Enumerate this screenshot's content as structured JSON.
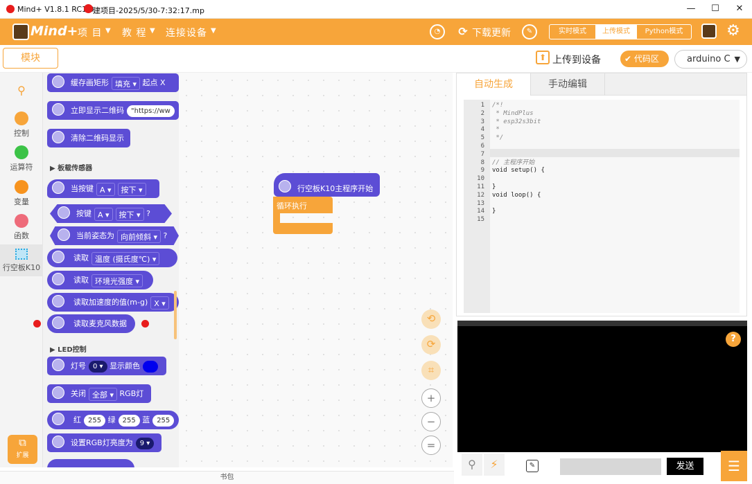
{
  "titlebar": {
    "app": "Mind+ V1.8.1 RC1.0",
    "file": "建项目-2025/5/30-7:32:17.mp",
    "minimize": "—",
    "maximize": "☐",
    "close": "✕"
  },
  "menubar": {
    "logo": "Mind+",
    "menus": [
      "项 目",
      "教 程",
      "连接设备"
    ],
    "download_update": "下载更新",
    "modes": [
      "实时模式",
      "上传模式",
      "Python模式"
    ],
    "active_mode": "上传模式"
  },
  "toolbar": {
    "modules_tab": "模块",
    "upload_button": "上传到设备",
    "code_area_button": "代码区",
    "board_select": "arduino C"
  },
  "categories": [
    {
      "label": "",
      "icon": "search-icon",
      "color": "#f7a53a"
    },
    {
      "label": "控制",
      "color": "#f7a53a"
    },
    {
      "label": "运算符",
      "color": "#3cc347"
    },
    {
      "label": "变量",
      "color": "#f7931e"
    },
    {
      "label": "函数",
      "color": "#ee6b7a"
    },
    {
      "label": "行空板K10",
      "color": "#2aa9e0"
    }
  ],
  "palette": {
    "b1": {
      "text": "缓存画矩形",
      "dd1": "填充 ▾",
      "tail": "起点 X"
    },
    "b2": {
      "text": "立即显示二维码",
      "pill": "\"https://ww"
    },
    "b3": {
      "text": "清除二维码显示"
    },
    "sec1": "▶ 板载传感器",
    "b4": {
      "text": "当按键",
      "dd1": "A ▾",
      "dd2": "按下 ▾"
    },
    "b5": {
      "text": "按键",
      "dd1": "A ▾",
      "dd2": "按下 ▾",
      "tail": "?"
    },
    "b6": {
      "text": "当前姿态为",
      "dd1": "向前倾斜 ▾",
      "tail": "?"
    },
    "b7": {
      "text": "读取",
      "dd1": "温度 (摄氏度℃) ▾"
    },
    "b8": {
      "text": "读取",
      "dd1": "环境光强度 ▾"
    },
    "b9": {
      "text": "读取加速度的值(m-g)",
      "dd1": "X ▾"
    },
    "b10": {
      "text": "读取麦克风数据"
    },
    "sec2": "▶ LED控制",
    "b11": {
      "text": "灯号",
      "pill": "0 ▾",
      "tail": "显示颜色"
    },
    "b12": {
      "text": "关闭",
      "dd1": "全部 ▾",
      "tail": "RGB灯"
    },
    "b13": {
      "t1": "红",
      "v1": "255",
      "t2": "绿",
      "v2": "255",
      "t3": "蓝",
      "v3": "255"
    },
    "b14": {
      "text": "设置RGB灯亮度为",
      "pill": "9 ▾"
    },
    "extension": "扩展"
  },
  "workspace": {
    "hat_block": "行空板K10主程序开始",
    "loop_block": "循环执行"
  },
  "code": {
    "tab_auto": "自动生成",
    "tab_manual": "手动编辑",
    "lines": [
      "/*!",
      " * MindPlus",
      " * esp32s3bit",
      " *",
      " */",
      "",
      "",
      "// 主程序开始",
      "void setup() {",
      "",
      "}",
      "void loop() {",
      "",
      "}",
      ""
    ]
  },
  "serial": {
    "send_button": "发送",
    "help": "?"
  },
  "bottom": {
    "bookmark": "书包"
  },
  "colors": {
    "accent": "#f7a53a",
    "block": "#5c4dd5"
  }
}
